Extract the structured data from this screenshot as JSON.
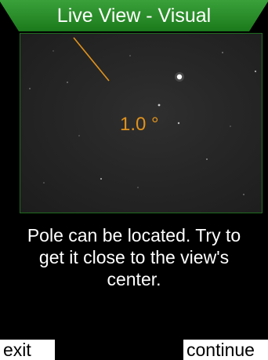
{
  "header": {
    "title": "Live View - Visual",
    "color": "#1f8a1f"
  },
  "live_view": {
    "angle_label": "1.0 °",
    "indicator_color": "#e0921c",
    "border_color": "#1f6b20"
  },
  "message": {
    "text": "Pole can be located. Try to\nget it close to the view's\ncenter."
  },
  "softkeys": {
    "left_label": "exit",
    "right_label": "continue"
  }
}
